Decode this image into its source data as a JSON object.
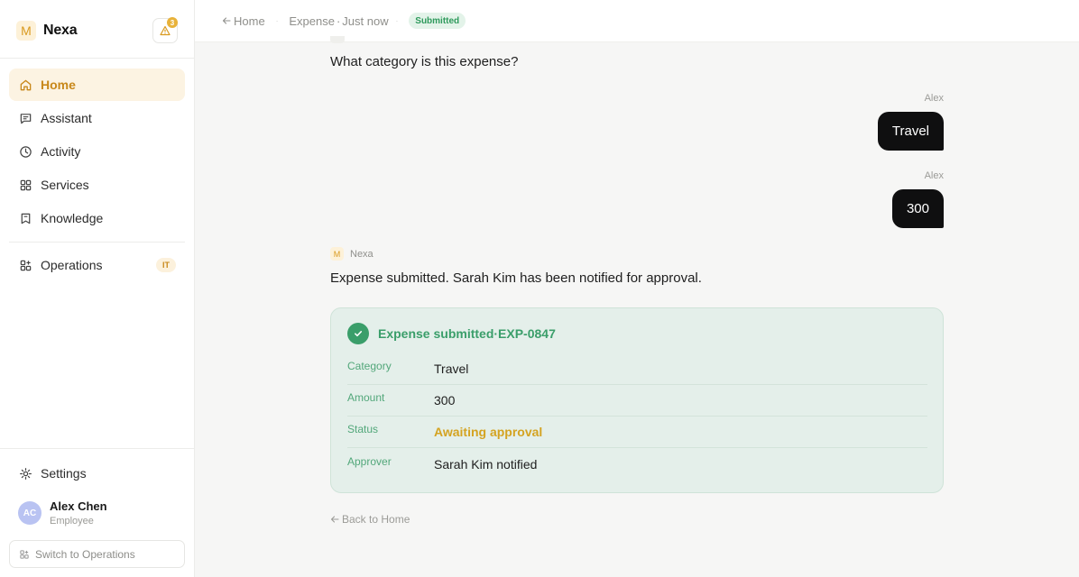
{
  "brand": {
    "name": "Nexa",
    "logo_letter": "M",
    "alert_count": "3"
  },
  "nav": {
    "items": [
      {
        "label": "Home",
        "icon": "home-icon"
      },
      {
        "label": "Assistant",
        "icon": "chat-icon"
      },
      {
        "label": "Activity",
        "icon": "clock-icon"
      },
      {
        "label": "Services",
        "icon": "grid-icon"
      },
      {
        "label": "Knowledge",
        "icon": "bookmark-icon"
      }
    ],
    "operations": {
      "label": "Operations",
      "tag": "IT",
      "icon": "operations-icon"
    },
    "settings": {
      "label": "Settings",
      "icon": "gear-icon"
    }
  },
  "user": {
    "initials": "AC",
    "name": "Alex Chen",
    "role": "Employee"
  },
  "switch": {
    "label": "Switch to Operations"
  },
  "topbar": {
    "back_label": "Home",
    "title": "Expense",
    "time": "Just now",
    "status": "Submitted"
  },
  "chat": {
    "question": "What category is this expense?",
    "messages": [
      {
        "sender": "Alex",
        "text": "Travel"
      },
      {
        "sender": "Alex",
        "text": "300"
      }
    ],
    "bot": {
      "name": "Nexa",
      "logo_letter": "M",
      "text": "Expense submitted. Sarah Kim has been notified for approval."
    }
  },
  "card": {
    "title": "Expense submitted",
    "id": "EXP-0847",
    "rows": [
      {
        "label": "Category",
        "value": "Travel"
      },
      {
        "label": "Amount",
        "value": "300"
      },
      {
        "label": "Status",
        "value": "Awaiting approval"
      },
      {
        "label": "Approver",
        "value": "Sarah Kim notified"
      }
    ]
  },
  "back_home": {
    "label": "Back to Home"
  },
  "colors": {
    "accent": "#c8881a",
    "success": "#3a9e6a",
    "warning": "#d4a321",
    "bubble": "#0f0f10"
  }
}
